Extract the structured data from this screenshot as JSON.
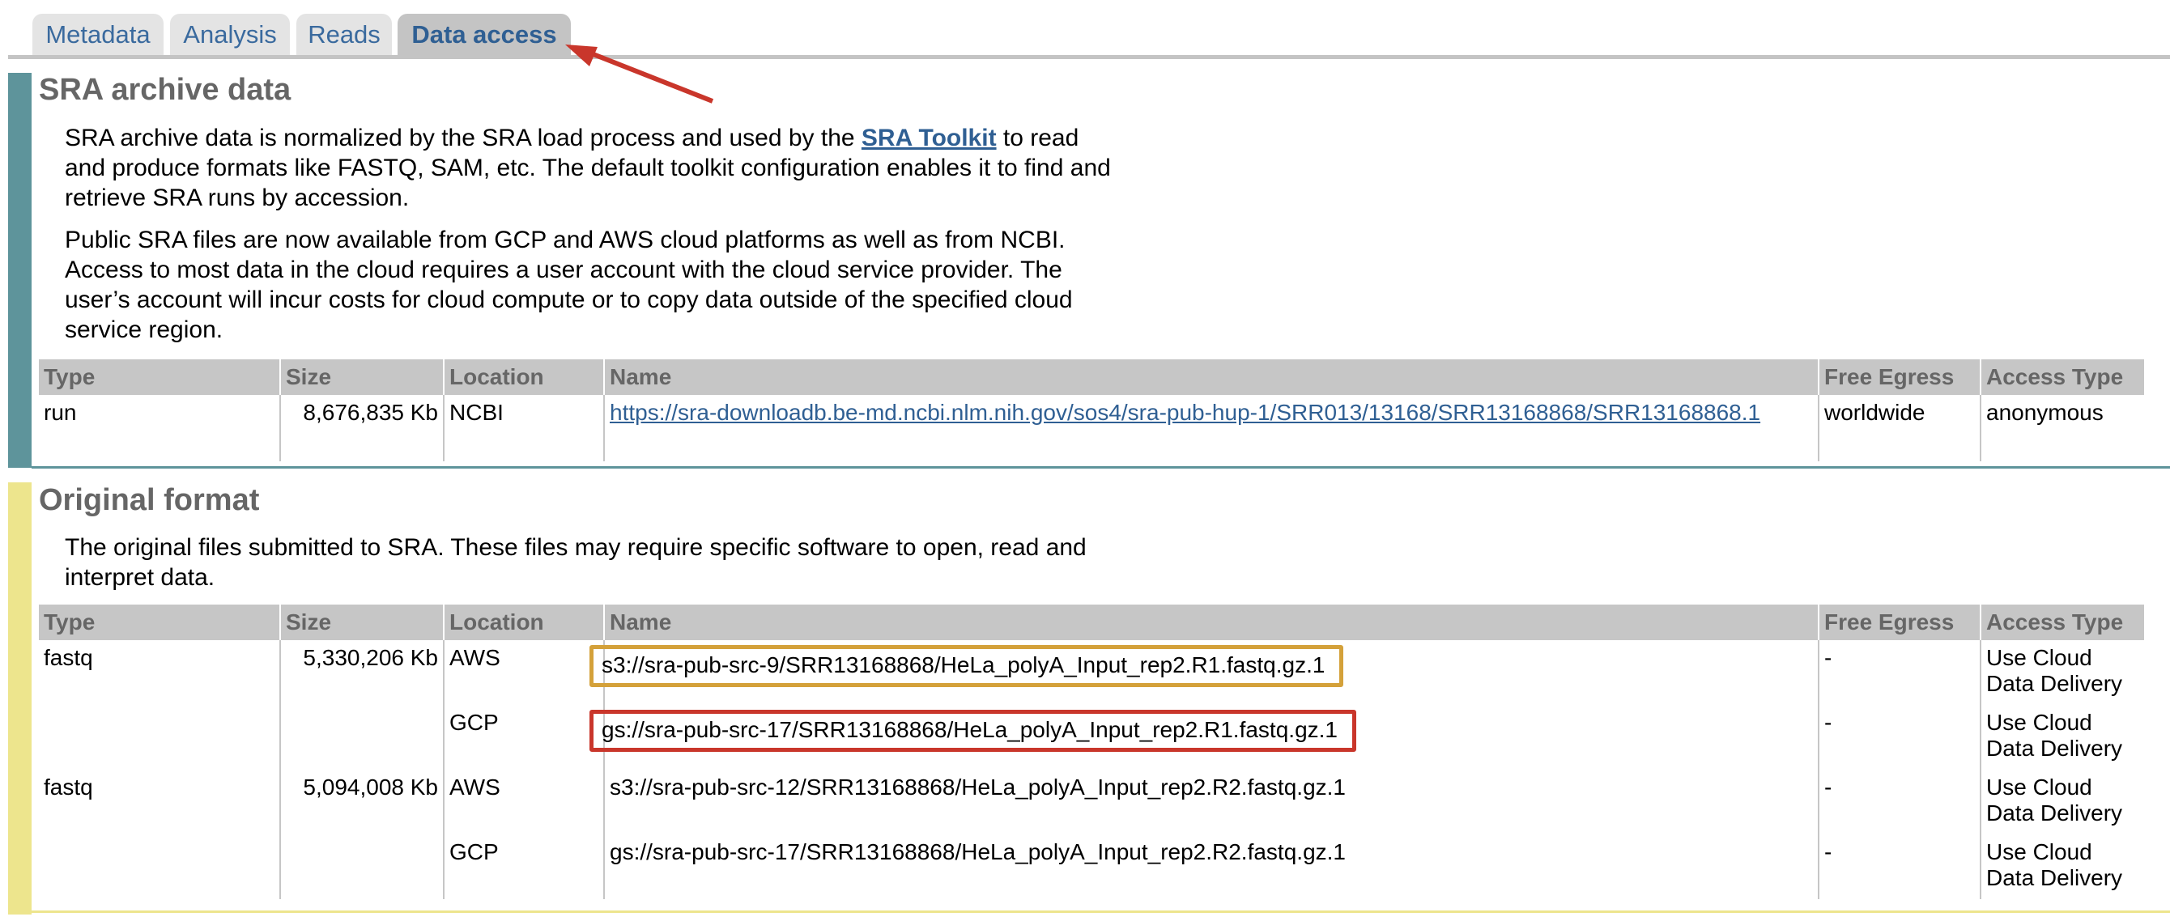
{
  "tabs": [
    {
      "label": "Metadata"
    },
    {
      "label": "Analysis"
    },
    {
      "label": "Reads"
    },
    {
      "label": "Data access"
    }
  ],
  "sra_section": {
    "title": "SRA archive data",
    "para1_before": "SRA archive data is normalized by the SRA load process and used by the ",
    "toolkit_link": "SRA Toolkit",
    "para1_after": " to read and produce formats like FASTQ, SAM, etc. The default toolkit configuration enables it to find and retrieve SRA runs by accession.",
    "para2": "Public SRA files are now available from GCP and AWS cloud platforms as well as from NCBI. Access to most data in the cloud requires a user account with the cloud service provider. The user’s account will incur costs for cloud compute or to copy data outside of the specified cloud service region.",
    "columns": [
      "Type",
      "Size",
      "Location",
      "Name",
      "Free Egress",
      "Access Type"
    ],
    "rows": [
      {
        "type": "run",
        "size": "8,676,835 Kb",
        "location": "NCBI",
        "name": "https://sra-downloadb.be-md.ncbi.nlm.nih.gov/sos4/sra-pub-hup-1/SRR013/13168/SRR13168868/SRR13168868.1",
        "free_egress": "worldwide",
        "access_type": "anonymous"
      }
    ]
  },
  "original_section": {
    "title": "Original format",
    "para": "The original files submitted to SRA. These files may require specific software to open, read and interpret data.",
    "columns": [
      "Type",
      "Size",
      "Location",
      "Name",
      "Free Egress",
      "Access Type"
    ],
    "rows": [
      {
        "type": "fastq",
        "size": "5,330,206 Kb",
        "location": "AWS",
        "name": "s3://sra-pub-src-9/SRR13168868/HeLa_polyA_Input_rep2.R1.fastq.gz.1",
        "free_egress": "-",
        "access_type": "Use Cloud Data Delivery"
      },
      {
        "type": "",
        "size": "",
        "location": "GCP",
        "name": "gs://sra-pub-src-17/SRR13168868/HeLa_polyA_Input_rep2.R1.fastq.gz.1",
        "free_egress": "-",
        "access_type": "Use Cloud Data Delivery"
      },
      {
        "type": "fastq",
        "size": "5,094,008 Kb",
        "location": "AWS",
        "name": "s3://sra-pub-src-12/SRR13168868/HeLa_polyA_Input_rep2.R2.fastq.gz.1",
        "free_egress": "-",
        "access_type": "Use Cloud Data Delivery"
      },
      {
        "type": "",
        "size": "",
        "location": "GCP",
        "name": "gs://sra-pub-src-17/SRR13168868/HeLa_polyA_Input_rep2.R2.fastq.gz.1",
        "free_egress": "-",
        "access_type": "Use Cloud Data Delivery"
      }
    ]
  },
  "colors": {
    "sra_accent": "#5e949b",
    "original_accent": "#ede58d",
    "link": "#2f5f93",
    "highlight_orange": "#d4a13a",
    "highlight_red": "#c9362b"
  }
}
